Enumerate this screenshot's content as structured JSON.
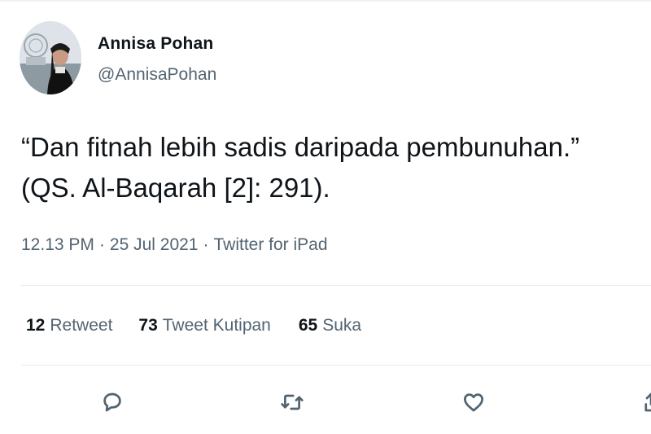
{
  "author": {
    "display_name": "Annisa Pohan",
    "handle": "@AnnisaPohan",
    "avatar_icon": "profile-photo"
  },
  "tweet": {
    "lines": [
      "“Dan fitnah lebih sadis daripada pembunuhan.”",
      "(QS. Al-Baqarah [2]: 291)."
    ]
  },
  "meta": {
    "time": "12.13 PM",
    "separator": "·",
    "date": "25 Jul 2021",
    "source": "Twitter for iPad"
  },
  "stats": {
    "retweets": {
      "count": "12",
      "label": "Retweet"
    },
    "quotes": {
      "count": "73",
      "label": "Tweet Kutipan"
    },
    "likes": {
      "count": "65",
      "label": "Suka"
    }
  },
  "actions": {
    "reply_icon": "reply-icon",
    "retweet_icon": "retweet-icon",
    "like_icon": "heart-icon",
    "share_icon": "share-icon"
  },
  "colors": {
    "primary_text": "#0f1419",
    "secondary_text": "#536471",
    "divider": "#e6ecf0"
  }
}
